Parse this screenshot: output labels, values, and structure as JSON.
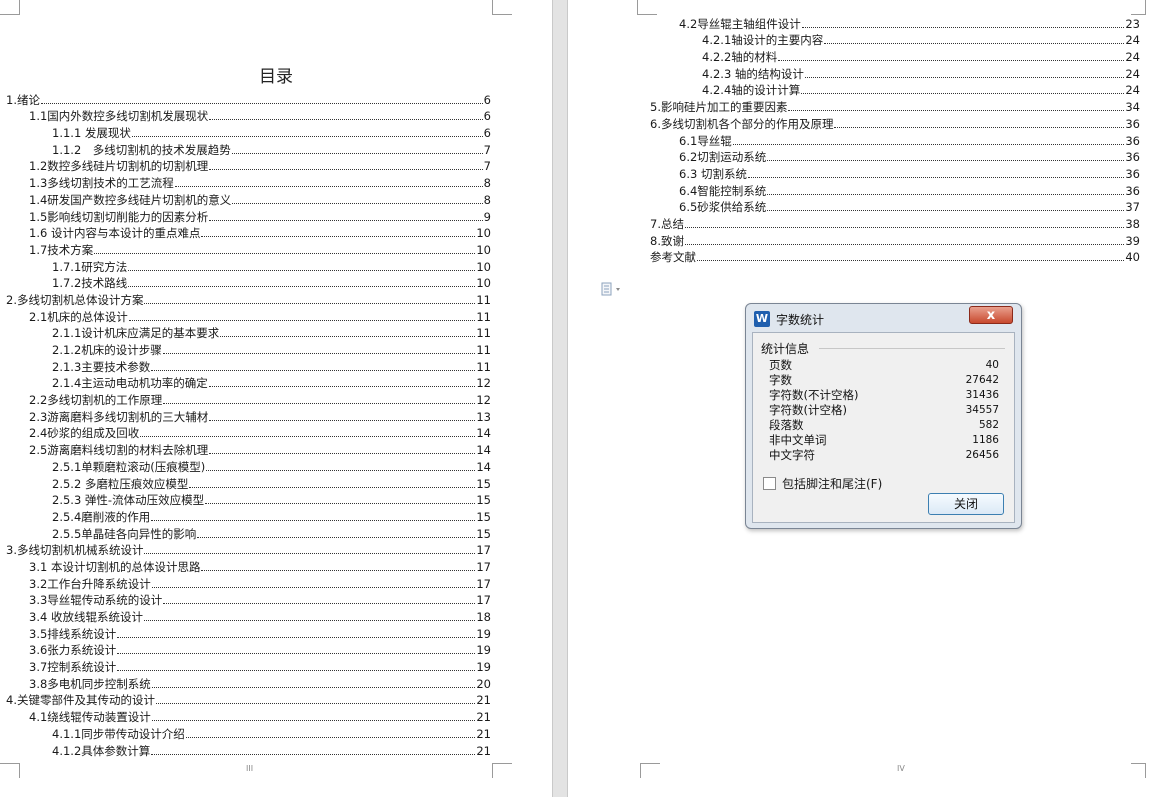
{
  "toc_left": {
    "title": "目录",
    "entries": [
      {
        "level": 1,
        "text": "1.绪论",
        "page": "6"
      },
      {
        "level": 2,
        "text": "1.1国内外数控多线切割机发展现状",
        "page": "6"
      },
      {
        "level": 3,
        "text": "1.1.1 发展现状",
        "page": "6"
      },
      {
        "level": 3,
        "text": "1.1.2　多线切割机的技术发展趋势",
        "page": "7"
      },
      {
        "level": 2,
        "text": "1.2数控多线硅片切割机的切割机理",
        "page": "7"
      },
      {
        "level": 2,
        "text": "1.3多线切割技术的工艺流程",
        "page": "8"
      },
      {
        "level": 2,
        "text": "1.4研发国产数控多线硅片切割机的意义",
        "page": "8"
      },
      {
        "level": 2,
        "text": "1.5影响线切割切削能力的因素分析",
        "page": "9"
      },
      {
        "level": 2,
        "text": "1.6 设计内容与本设计的重点难点",
        "page": "10"
      },
      {
        "level": 2,
        "text": "1.7技术方案",
        "page": "10"
      },
      {
        "level": 3,
        "text": "1.7.1研究方法",
        "page": "10"
      },
      {
        "level": 3,
        "text": "1.7.2技术路线",
        "page": "10"
      },
      {
        "level": 1,
        "text": "2.多线切割机总体设计方案",
        "page": "11"
      },
      {
        "level": 2,
        "text": "2.1机床的总体设计",
        "page": "11"
      },
      {
        "level": 3,
        "text": "2.1.1设计机床应满足的基本要求",
        "page": "11"
      },
      {
        "level": 3,
        "text": "2.1.2机床的设计步骤",
        "page": "11"
      },
      {
        "level": 3,
        "text": "2.1.3主要技术参数",
        "page": "11"
      },
      {
        "level": 3,
        "text": "2.1.4主运动电动机功率的确定",
        "page": "12"
      },
      {
        "level": 2,
        "text": "2.2多线切割机的工作原理",
        "page": "12"
      },
      {
        "level": 2,
        "text": "2.3游离磨料多线切割机的三大辅材",
        "page": "13"
      },
      {
        "level": 2,
        "text": "2.4砂浆的组成及回收",
        "page": "14"
      },
      {
        "level": 2,
        "text": "2.5游离磨料线切割的材料去除机理",
        "page": "14"
      },
      {
        "level": 3,
        "text": "2.5.1单颗磨粒滚动(压痕模型)",
        "page": "14"
      },
      {
        "level": 3,
        "text": "2.5.2 多磨粒压痕效应模型",
        "page": "15"
      },
      {
        "level": 3,
        "text": "2.5.3 弹性-流体动压效应模型",
        "page": "15"
      },
      {
        "level": 3,
        "text": "2.5.4磨削液的作用",
        "page": "15"
      },
      {
        "level": 3,
        "text": "2.5.5单晶硅各向异性的影响",
        "page": "15"
      },
      {
        "level": 1,
        "text": "3.多线切割机机械系统设计",
        "page": "17"
      },
      {
        "level": 2,
        "text": "3.1 本设计切割机的总体设计思路",
        "page": "17"
      },
      {
        "level": 2,
        "text": "3.2工作台升降系统设计",
        "page": "17"
      },
      {
        "level": 2,
        "text": "3.3导丝辊传动系统的设计",
        "page": "17"
      },
      {
        "level": 2,
        "text": "3.4 收放线辊系统设计",
        "page": "18"
      },
      {
        "level": 2,
        "text": "3.5排线系统设计",
        "page": "19"
      },
      {
        "level": 2,
        "text": "3.6张力系统设计",
        "page": "19"
      },
      {
        "level": 2,
        "text": "3.7控制系统设计",
        "page": "19"
      },
      {
        "level": 2,
        "text": "3.8多电机同步控制系统",
        "page": "20"
      },
      {
        "level": 1,
        "text": "4.关键零部件及其传动的设计",
        "page": "21"
      },
      {
        "level": 2,
        "text": "4.1绕线辊传动装置设计",
        "page": "21"
      },
      {
        "level": 3,
        "text": "4.1.1同步带传动设计介绍",
        "page": "21"
      },
      {
        "level": 3,
        "text": "4.1.2具体参数计算",
        "page": "21"
      }
    ],
    "page_number": "III"
  },
  "toc_right": {
    "entries": [
      {
        "level": 2,
        "text": "4.2导丝辊主轴组件设计",
        "page": "23"
      },
      {
        "level": 3,
        "text": "4.2.1轴设计的主要内容",
        "page": "24"
      },
      {
        "level": 3,
        "text": "4.2.2轴的材料",
        "page": "24"
      },
      {
        "level": 3,
        "text": "4.2.3 轴的结构设计",
        "page": "24"
      },
      {
        "level": 3,
        "text": "4.2.4轴的设计计算",
        "page": "24"
      },
      {
        "level": 1,
        "text": "5.影响硅片加工的重要因素",
        "page": "34"
      },
      {
        "level": 1,
        "text": "6.多线切割机各个部分的作用及原理",
        "page": "36"
      },
      {
        "level": 2,
        "text": "6.1导丝辊",
        "page": "36"
      },
      {
        "level": 2,
        "text": "6.2切割运动系统",
        "page": "36"
      },
      {
        "level": 2,
        "text": "6.3 切割系统",
        "page": "36"
      },
      {
        "level": 2,
        "text": "6.4智能控制系统",
        "page": "36"
      },
      {
        "level": 2,
        "text": "6.5砂浆供给系统",
        "page": "37"
      },
      {
        "level": 1,
        "text": "7.总结",
        "page": "38"
      },
      {
        "level": 1,
        "text": "8.致谢",
        "page": "39"
      },
      {
        "level": 1,
        "text": "参考文献",
        "page": "40"
      }
    ],
    "page_number": "IV"
  },
  "word_count_dialog": {
    "app_icon": "W",
    "title": "字数统计",
    "close_glyph": "x",
    "section_label": "统计信息",
    "stats": [
      {
        "label": "页数",
        "value": "40"
      },
      {
        "label": "字数",
        "value": "27642"
      },
      {
        "label": "字符数(不计空格)",
        "value": "31436"
      },
      {
        "label": "字符数(计空格)",
        "value": "34557"
      },
      {
        "label": "段落数",
        "value": "582"
      },
      {
        "label": "非中文单词",
        "value": "1186"
      },
      {
        "label": "中文字符",
        "value": "26456"
      }
    ],
    "include_footnotes_label": "包括脚注和尾注(F)",
    "include_footnotes_checked": false,
    "close_button_label": "关闭"
  },
  "colors": {
    "dialog_close": "#c8492e",
    "button_border": "#3c7fb1",
    "wps_blue": "#1f5fae"
  }
}
